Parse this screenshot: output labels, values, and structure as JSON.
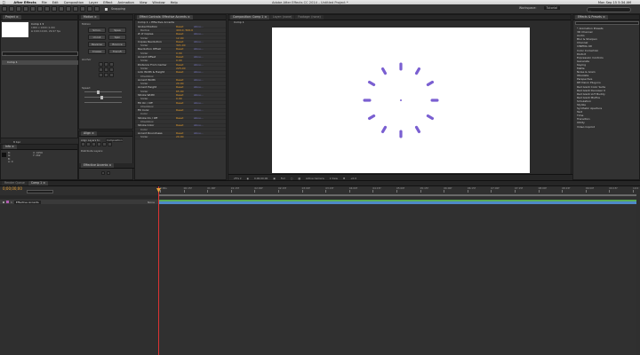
{
  "menubar": {
    "apple": "",
    "app": "After Effects",
    "items": [
      "File",
      "Edit",
      "Composition",
      "Layer",
      "Effect",
      "Animation",
      "View",
      "Window",
      "Help"
    ],
    "window_title": "Adobe After Effects CC 2014 – Untitled Project *",
    "clock": "Mon Sep 15 5:34 AM"
  },
  "toolbar": {
    "snapping_label": "Snapping",
    "workspace_label": "Workspace:",
    "workspace_value": "Tutorial",
    "search_placeholder": ""
  },
  "project_panel": {
    "tab": "Project ≡",
    "comp_name": "Comp 1 ▾",
    "comp_info_1": "1000 x 1000 (1.00)",
    "comp_info_2": "Δ 0;00;10;00, 29.97 fps",
    "item_name": "Comp 1",
    "footer": "8 bpc"
  },
  "motion_panel": {
    "tab": "Motion ≡",
    "section_motion": "Motion",
    "buttons": [
      "Smoo.",
      "Spea",
      "Unroll",
      "Spin",
      "Reverse",
      "Bounce",
      "Crease",
      "Transfr"
    ],
    "section_anchor": "Anchor",
    "section_speed": "Speed"
  },
  "effect_controls": {
    "tabs": [
      "Effect Controls: Effective Accents ≡",
      "Comp 1 • Effective Accents"
    ],
    "rows": [
      {
        "label": "Global Position",
        "value": "Reset",
        "extra": "Abou...",
        "sub": false
      },
      {
        "label": "Radius",
        "value": "400.0, 500.0",
        "extra": "",
        "sub": true
      },
      {
        "label": "# of Copies",
        "value": "Reset",
        "extra": "Abou...",
        "sub": false
      },
      {
        "label": "Slider",
        "value": "12.00",
        "extra": "",
        "sub": true
      },
      {
        "label": "Copies Revolution",
        "value": "Reset",
        "extra": "Abou...",
        "sub": false
      },
      {
        "label": "Slider",
        "value": "321.00",
        "extra": "",
        "sub": true
      },
      {
        "label": "Revolution Offset",
        "value": "Reset",
        "extra": "Abou...",
        "sub": false
      },
      {
        "label": "Slider",
        "value": "0.00",
        "extra": "",
        "sub": true
      },
      {
        "label": "Accent Offset",
        "value": "Reset",
        "extra": "Abou...",
        "sub": false
      },
      {
        "label": "Slider",
        "value": "0.00",
        "extra": "",
        "sub": true
      },
      {
        "label": "Distance From Center",
        "value": "Reset",
        "extra": "Abou...",
        "sub": false
      },
      {
        "label": "Slider",
        "value": "225.00",
        "extra": "",
        "sub": true
      },
      {
        "label": "Link Width & Height",
        "value": "Reset",
        "extra": "Abou...",
        "sub": false
      },
      {
        "label": "Checkbox",
        "value": "",
        "extra": "",
        "sub": true
      },
      {
        "label": "Accent Width",
        "value": "Reset",
        "extra": "Abou...",
        "sub": false
      },
      {
        "label": "Slider",
        "value": "20.00",
        "extra": "",
        "sub": true
      },
      {
        "label": "Accent Height",
        "value": "Reset",
        "extra": "Abou...",
        "sub": false
      },
      {
        "label": "Slider",
        "value": "65.00",
        "extra": "",
        "sub": true
      },
      {
        "label": "Stroke Width",
        "value": "Reset",
        "extra": "Abou...",
        "sub": false
      },
      {
        "label": "Slider",
        "value": "0.00",
        "extra": "",
        "sub": true
      },
      {
        "label": "Fill On / Off",
        "value": "Reset",
        "extra": "Abou...",
        "sub": false
      },
      {
        "label": "Checkbox",
        "value": "",
        "extra": "",
        "sub": true
      },
      {
        "label": "Fill Color",
        "value": "Reset",
        "extra": "Abou...",
        "sub": false
      },
      {
        "label": "Color",
        "value": "",
        "extra": "",
        "sub": true
      },
      {
        "label": "Stroke On / Off",
        "value": "Reset",
        "extra": "Abou...",
        "sub": false
      },
      {
        "label": "Checkbox",
        "value": "",
        "extra": "",
        "sub": true
      },
      {
        "label": "Stroke Color",
        "value": "Reset",
        "extra": "Abou...",
        "sub": false
      },
      {
        "label": "Color",
        "value": "",
        "extra": "",
        "sub": true
      },
      {
        "label": "Accent Roundness",
        "value": "Reset",
        "extra": "Abou...",
        "sub": false
      },
      {
        "label": "Slider",
        "value": "20.00",
        "extra": "",
        "sub": true
      }
    ]
  },
  "composition": {
    "tabs": [
      "Composition: Comp 1 ≡",
      "Layer: (none)",
      "Footage: (none)"
    ],
    "breadcrumb": "Comp 1",
    "footer": [
      "25% ▾",
      "0;00;00;00",
      "Full",
      "Active Camera",
      "1 View",
      "+0.0"
    ],
    "accent_color": "#7a5fd1",
    "accents_count": 12
  },
  "align_panel": {
    "tab": "Align ≡",
    "align_label": "Align Layers to:",
    "align_value": "Composition",
    "distribute_label": "Distribute Layers:",
    "effective_tab": "Effective Accents ≡"
  },
  "info_panel": {
    "tab": "Info ≡",
    "r": "R:",
    "g": "G:",
    "b": "B:",
    "a": "A: 0",
    "x": "X: 1050",
    "y": "Y: 262"
  },
  "effects_presets": {
    "tab": "Effects & Presets ≡",
    "items": [
      "* Animation Presets",
      "3D Channel",
      "Audio",
      "Blur & Sharpen",
      "Channel",
      "CINEMA 4D",
      "Color Correction",
      "Distort",
      "Expression Controls",
      "Generate",
      "Keying",
      "Matte",
      "Noise & Grain",
      "Obsolete",
      "Perspective",
      "RE:Vision Plug-ins",
      "Red Giant Color Suite",
      "Red Giant Denoiser II",
      "Red Giant LUT Buddy",
      "Red Giant MisFire",
      "Simulation",
      "Stylize",
      "Synthetic Aperture",
      "Text",
      "Time",
      "Transition",
      "Utility",
      "Video Copilot"
    ]
  },
  "timeline": {
    "render_tab": "Render Queue",
    "comp_tab": "Comp 1 ≡",
    "timecode": "0;00;00;00",
    "layer_num": "1",
    "layer_name": "Effective Accents",
    "mode": "None",
    "ruler": [
      "0:00s",
      "00:15f",
      "01:00f",
      "01:15f",
      "02:00f",
      "02:15f",
      "03:00f",
      "03:15f",
      "04:00f",
      "04:15f",
      "05:00f",
      "05:15f",
      "06:00f",
      "06:15f",
      "07:00f",
      "07:15f",
      "08:00f",
      "08:15f",
      "09:00f",
      "09:15f",
      "10:0"
    ],
    "bar_color": "#4e89c8",
    "bar_green": "#5aaa55"
  }
}
